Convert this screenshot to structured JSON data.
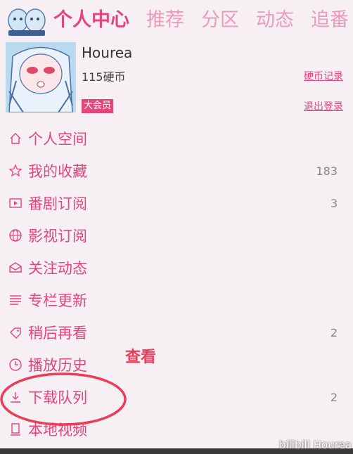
{
  "header": {
    "tabs": [
      {
        "label": "个人中心",
        "active": true
      },
      {
        "label": "推荐"
      },
      {
        "label": "分区"
      },
      {
        "label": "动态"
      },
      {
        "label": "追番"
      }
    ]
  },
  "profile": {
    "username": "Hourea",
    "coins": "115硬币",
    "vip_badge": "大会员",
    "coin_log_link": "硬币记录",
    "logout_link": "退出登录"
  },
  "menu": [
    {
      "label": "个人空间",
      "icon": "home-icon",
      "count": ""
    },
    {
      "label": "我的收藏",
      "icon": "star-icon",
      "count": "183"
    },
    {
      "label": "番剧订阅",
      "icon": "tv-play-icon",
      "count": "3"
    },
    {
      "label": "影视订阅",
      "icon": "globe-icon",
      "count": ""
    },
    {
      "label": "关注动态",
      "icon": "envelope-icon",
      "count": ""
    },
    {
      "label": "专栏更新",
      "icon": "lines-icon",
      "count": ""
    },
    {
      "label": "稍后再看",
      "icon": "tag-icon",
      "count": "2"
    },
    {
      "label": "播放历史",
      "icon": "clock-icon",
      "count": ""
    },
    {
      "label": "下载队列",
      "icon": "download-icon",
      "count": "2"
    },
    {
      "label": "本地视频",
      "icon": "local-video-icon",
      "count": ""
    }
  ],
  "annotation": {
    "text": "查看"
  },
  "watermark": "bilibili Hourea",
  "colors": {
    "accent": "#e4457a",
    "tab_inactive": "#ec9bb6",
    "background": "#f6f0f5",
    "annotation_red": "#e83e5a"
  }
}
